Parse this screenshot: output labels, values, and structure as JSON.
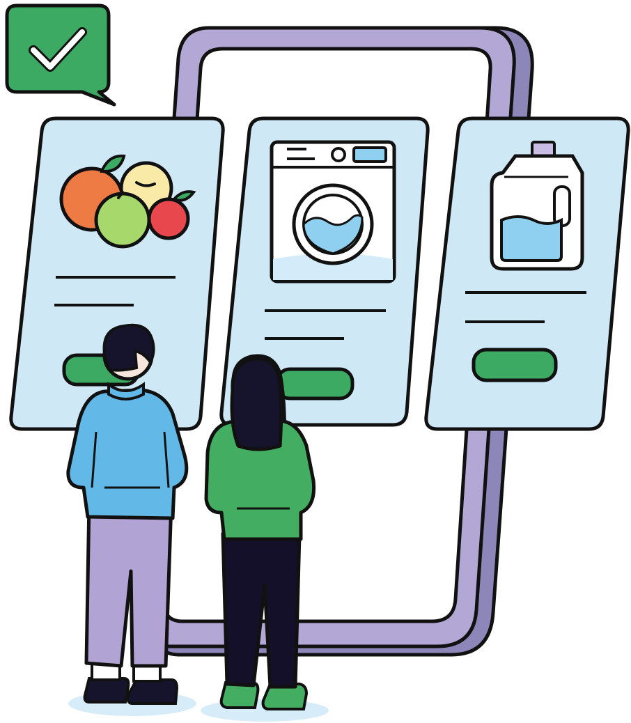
{
  "colors": {
    "outline": "#111111",
    "phone_frame": "#b3a7d6",
    "phone_frame_shade": "#8c87b8",
    "card_bg": "#cfe8f6",
    "accent_green": "#3daa63",
    "man_shirt": "#62b8e6",
    "man_pants": "#b1a3d3",
    "woman_shirt": "#43ad61",
    "woman_pants": "#14102a",
    "hair": "#16142c",
    "skin": "#f7e6dd",
    "water": "#8fd0f0",
    "floor_shadow": "#d6ecf8"
  },
  "icons": {
    "badge": "check-icon",
    "card_1": "fruit-icon",
    "card_2": "washing-machine-icon",
    "card_3": "detergent-bottle-icon"
  },
  "cards": [
    {
      "name": "product-card-fruit",
      "icon": "fruit-icon",
      "has_button": true
    },
    {
      "name": "product-card-washing-machine",
      "icon": "washing-machine-icon",
      "has_button": true
    },
    {
      "name": "product-card-detergent",
      "icon": "detergent-bottle-icon",
      "has_button": true
    }
  ]
}
